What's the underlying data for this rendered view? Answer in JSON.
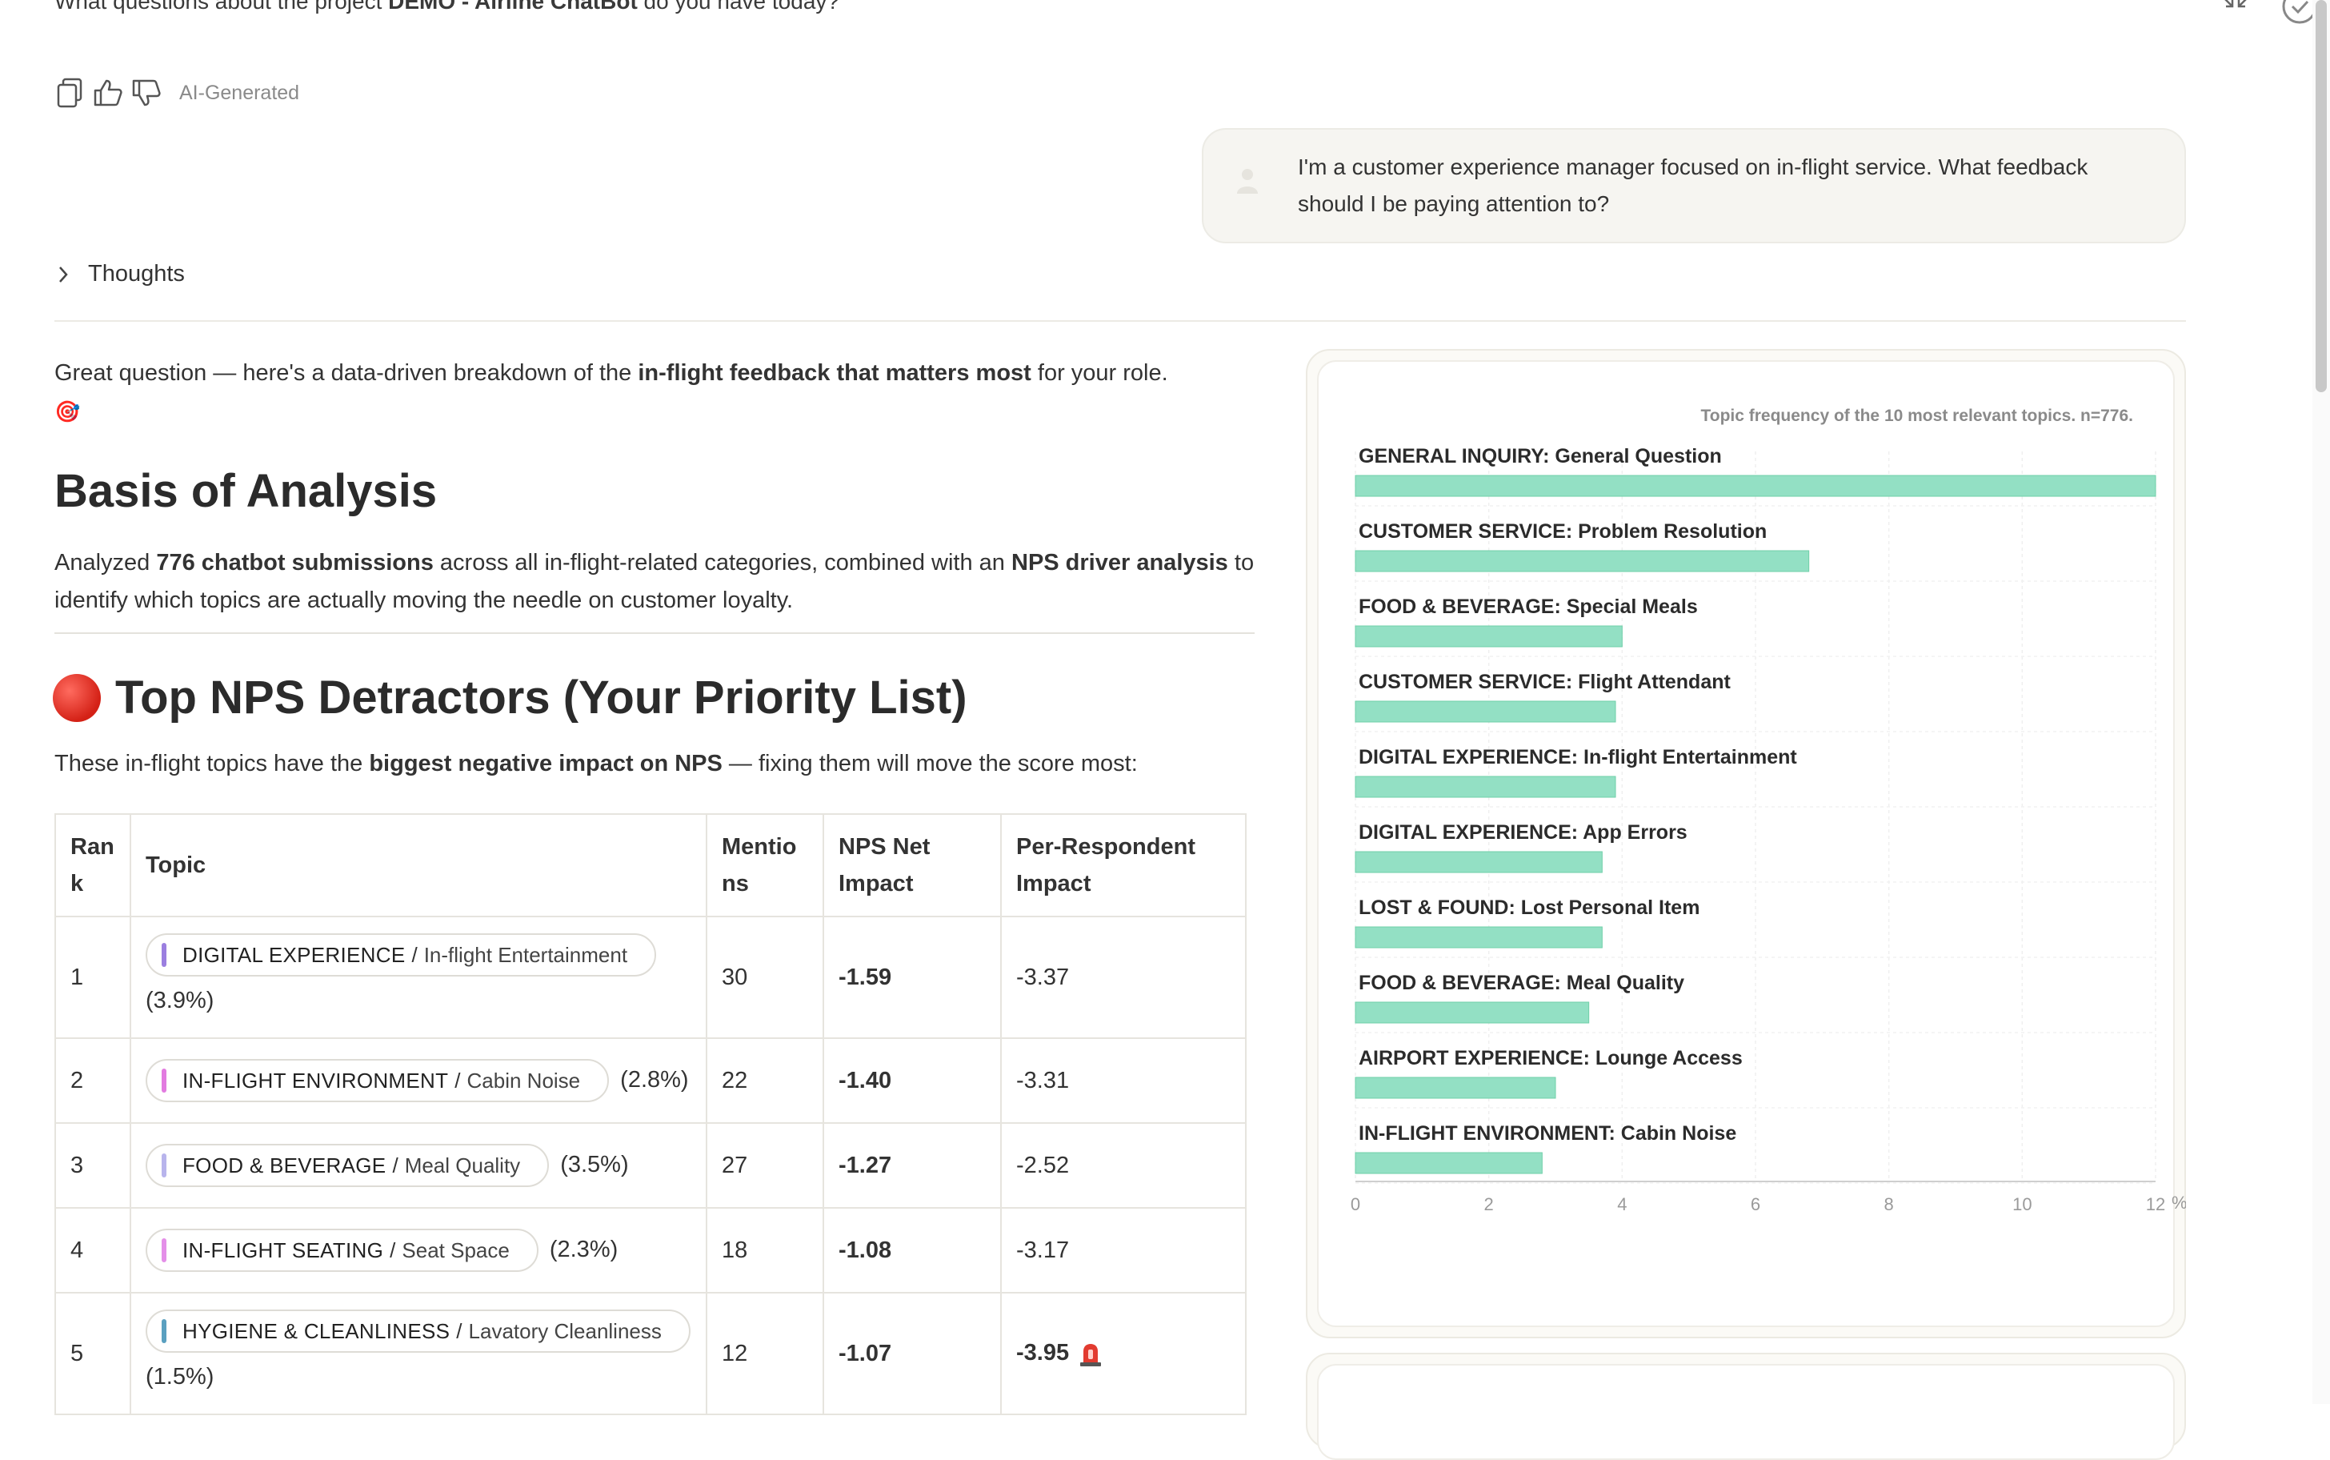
{
  "header": {
    "question_prefix": "What questions about the project ",
    "project_name": "DEMO - Airline ChatBot",
    "question_suffix": " do you have today?",
    "ai_generated": "AI-Generated"
  },
  "user_message": "I'm a customer experience manager focused on in-flight service. What feedback should I be paying attention to?",
  "thoughts_label": "Thoughts",
  "intro": {
    "before": "Great question — here's a data-driven breakdown of the ",
    "bold": "in-flight feedback that matters most",
    "after": " for your role.",
    "emoji": "🎯"
  },
  "basis": {
    "heading": "Basis of Analysis",
    "t1": "Analyzed ",
    "b1": "776 chatbot submissions",
    "t2": " across all in-flight-related categories, combined with an ",
    "b2": "NPS driver analysis",
    "t3": " to identify which topics are actually moving the needle on customer loyalty."
  },
  "detractors": {
    "heading": "Top NPS Detractors (Your Priority List)",
    "t1": "These in-flight topics have the ",
    "b1": "biggest negative impact on NPS",
    "t2": " — fixing them will move the score most:"
  },
  "table": {
    "headers": [
      "Ran\nk",
      "Topic",
      "Mentio\nns",
      "NPS Net\nImpact",
      "Per-Respondent\nImpact"
    ],
    "rows": [
      {
        "rank": "1",
        "category": "DIGITAL EXPERIENCE",
        "sub": "In-flight Entertainment",
        "pct": "(3.9%)",
        "mentions": "30",
        "net": "-1.59",
        "per": "-3.37",
        "bar": "#9b7fe0"
      },
      {
        "rank": "2",
        "category": "IN-FLIGHT ENVIRONMENT",
        "sub": "Cabin Noise",
        "pct": "(2.8%)",
        "mentions": "22",
        "net": "-1.40",
        "per": "-3.31",
        "bar": "#e27be0"
      },
      {
        "rank": "3",
        "category": "FOOD & BEVERAGE",
        "sub": "Meal Quality",
        "pct": "(3.5%)",
        "mentions": "27",
        "net": "-1.27",
        "per": "-2.52",
        "bar": "#b8b4ec"
      },
      {
        "rank": "4",
        "category": "IN-FLIGHT SEATING",
        "sub": "Seat Space",
        "pct": "(2.3%)",
        "mentions": "18",
        "net": "-1.08",
        "per": "-3.17",
        "bar": "#e48fe8"
      },
      {
        "rank": "5",
        "category": "HYGIENE & CLEANLINESS",
        "sub": "Lavatory Cleanliness",
        "pct": "(1.5%)",
        "mentions": "12",
        "net": "-1.07",
        "per": "-3.95",
        "bar": "#5aa0c0"
      }
    ]
  },
  "chart_data": {
    "type": "bar",
    "orientation": "horizontal",
    "title": "Topic frequency of the 10 most relevant topics. n=776.",
    "categories": [
      "GENERAL INQUIRY: General Question",
      "CUSTOMER SERVICE: Problem Resolution",
      "FOOD & BEVERAGE: Special Meals",
      "CUSTOMER SERVICE: Flight Attendant",
      "DIGITAL EXPERIENCE: In-flight Entertainment",
      "DIGITAL EXPERIENCE: App Errors",
      "LOST & FOUND: Lost Personal Item",
      "FOOD & BEVERAGE: Meal Quality",
      "AIRPORT EXPERIENCE: Lounge Access",
      "IN-FLIGHT ENVIRONMENT: Cabin Noise"
    ],
    "values": [
      12.0,
      6.8,
      4.0,
      3.9,
      3.9,
      3.7,
      3.7,
      3.5,
      3.0,
      2.8
    ],
    "xlim": [
      0,
      12
    ],
    "xticks": [
      "0",
      "2",
      "4",
      "6",
      "8",
      "10",
      "12"
    ],
    "x_unit": "%",
    "grid": true,
    "bar_color": "#93e0c4"
  }
}
